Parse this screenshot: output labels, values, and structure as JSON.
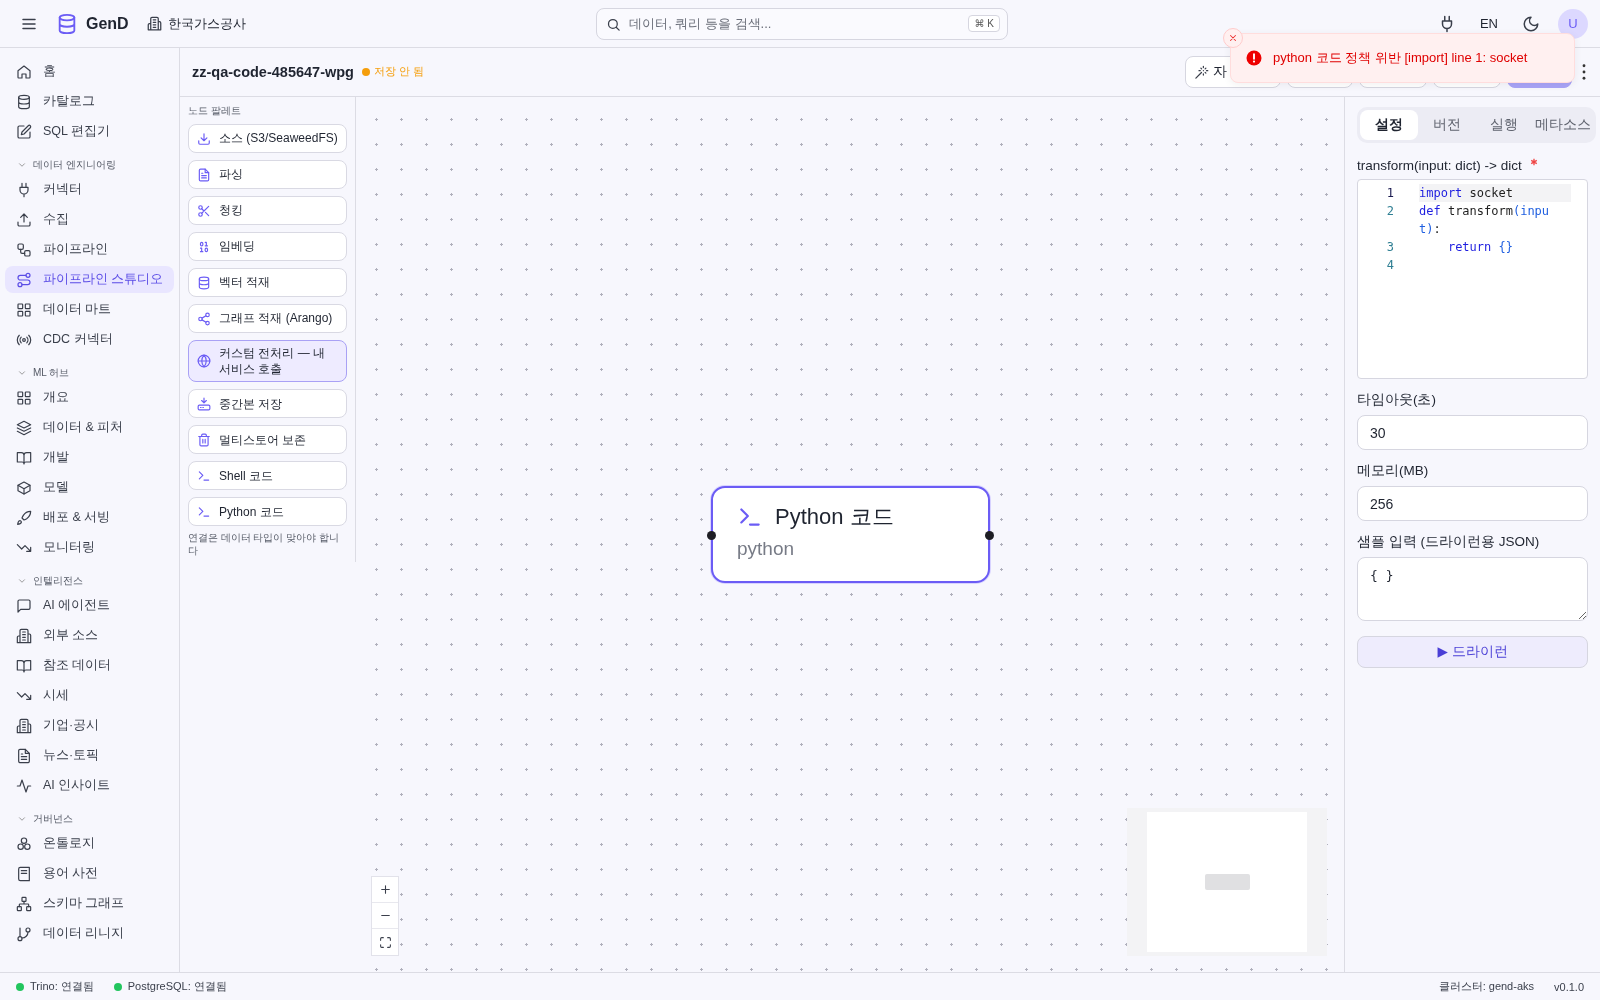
{
  "topbar": {
    "brand": "GenD",
    "org": "한국가스공사",
    "search": {
      "placeholder": "데이터, 쿼리 등을 검색...",
      "shortcut": "⌘ K"
    },
    "language": "EN",
    "avatar": "U"
  },
  "sidebar": {
    "sections": [
      {
        "items": [
          {
            "label": "홈",
            "selected": false
          },
          {
            "label": "카탈로그",
            "selected": false
          },
          {
            "label": "SQL 편집기",
            "selected": false
          }
        ]
      },
      {
        "title": "데이터 엔지니어링",
        "expanded": true,
        "items": [
          {
            "label": "커넥터",
            "selected": false
          },
          {
            "label": "수집",
            "selected": false
          },
          {
            "label": "파이프라인",
            "selected": false
          },
          {
            "label": "파이프라인 스튜디오",
            "selected": true
          },
          {
            "label": "데이터 마트",
            "selected": false
          },
          {
            "label": "CDC 커넥터",
            "selected": false
          }
        ]
      },
      {
        "title": "ML 허브",
        "expanded": true,
        "items": [
          {
            "label": "개요",
            "selected": false
          },
          {
            "label": "데이터 & 피처",
            "selected": false
          },
          {
            "label": "개발",
            "selected": false
          },
          {
            "label": "모델",
            "selected": false
          },
          {
            "label": "배포 & 서빙",
            "selected": false
          },
          {
            "label": "모니터링",
            "selected": false
          }
        ]
      },
      {
        "title": "인텔리전스",
        "expanded": true,
        "items": [
          {
            "label": "AI 에이전트",
            "selected": false
          },
          {
            "label": "외부 소스",
            "selected": false
          },
          {
            "label": "참조 데이터",
            "selected": false
          },
          {
            "label": "시세",
            "selected": false
          },
          {
            "label": "기업·공시",
            "selected": false
          },
          {
            "label": "뉴스·토픽",
            "selected": false
          },
          {
            "label": "AI 인사이트",
            "selected": false
          }
        ]
      },
      {
        "title": "거버넌스",
        "expanded": true,
        "items": [
          {
            "label": "온톨로지",
            "selected": false
          },
          {
            "label": "용어 사전",
            "selected": false
          },
          {
            "label": "스키마 그래프",
            "selected": false
          },
          {
            "label": "데이터 리니지",
            "selected": false
          }
        ]
      }
    ]
  },
  "pipeline": {
    "name": "zz-qa-code-485647-wpg",
    "save_status": "저장 안 됨",
    "toolbar_buttons": [
      {
        "kind": "outline",
        "label": "자"
      },
      {
        "kind": "outline"
      },
      {
        "kind": "outline"
      },
      {
        "kind": "outline"
      },
      {
        "kind": "primary"
      }
    ]
  },
  "palette": {
    "title": "노드 팔레트",
    "items": [
      {
        "label": "소스 (S3/SeaweedFS)",
        "selected": false
      },
      {
        "label": "파싱",
        "selected": false
      },
      {
        "label": "청킹",
        "selected": false
      },
      {
        "label": "임베딩",
        "selected": false
      },
      {
        "label": "벡터 적재",
        "selected": false
      },
      {
        "label": "그래프 적재 (Arango)",
        "selected": false
      },
      {
        "label": "커스텀 전처리 — 내 서비스 호출",
        "selected": true
      },
      {
        "label": "중간본 저장",
        "selected": false
      },
      {
        "label": "멀티스토어 보존",
        "selected": false
      },
      {
        "label": "Shell 코드",
        "selected": false
      },
      {
        "label": "Python 코드",
        "selected": false
      }
    ],
    "hint": "연결은 데이터 타입이 맞아야 합니다"
  },
  "canvas": {
    "nodes": [
      {
        "title": "Python 코드",
        "subtitle": "python",
        "selected": true
      }
    ]
  },
  "inspector": {
    "tabs": [
      {
        "label": "설정",
        "selected": true
      },
      {
        "label": "버전",
        "selected": false
      },
      {
        "label": "실행",
        "selected": false
      },
      {
        "label": "메타소스",
        "selected": false
      }
    ],
    "code_label": "transform(input: dict) -> dict",
    "required": true,
    "code_lines": [
      {
        "number": "1",
        "active": true,
        "tokens": [
          {
            "text": "import",
            "kind": "keyword"
          },
          {
            "text": " socket",
            "kind": "plain"
          }
        ]
      },
      {
        "number": "2",
        "active": false,
        "tokens": [
          {
            "text": "def",
            "kind": "keyword"
          },
          {
            "text": " transform",
            "kind": "plain"
          },
          {
            "text": "(input)",
            "kind": "bracket"
          },
          {
            "text": ":",
            "kind": "plain"
          }
        ]
      },
      {
        "number": "3",
        "active": false,
        "tokens": [
          {
            "text": "    return",
            "kind": "keyword"
          },
          {
            "text": " {}",
            "kind": "bracket"
          }
        ]
      },
      {
        "number": "4",
        "active": false
      }
    ],
    "fields": [
      {
        "kind": "input",
        "label": "타임아웃(초)",
        "value": "30"
      },
      {
        "kind": "input",
        "label": "메모리(MB)",
        "value": "256"
      },
      {
        "kind": "textarea",
        "label": "샘플 입력 (드라이런용 JSON)",
        "value": "{ }"
      }
    ],
    "run_button": "▶ 드라이런"
  },
  "toast": {
    "kind": "error",
    "message": "python 코드 정책 위반 [import] line 1: socket"
  },
  "status_bar": {
    "connections": [
      {
        "label": "Trino: 연결됨",
        "color": "#22c55e"
      },
      {
        "label": "PostgreSQL: 연결됨",
        "color": "#22c55e"
      }
    ],
    "cluster": "클러스터: gend-aks",
    "version": "v0.1.0"
  }
}
